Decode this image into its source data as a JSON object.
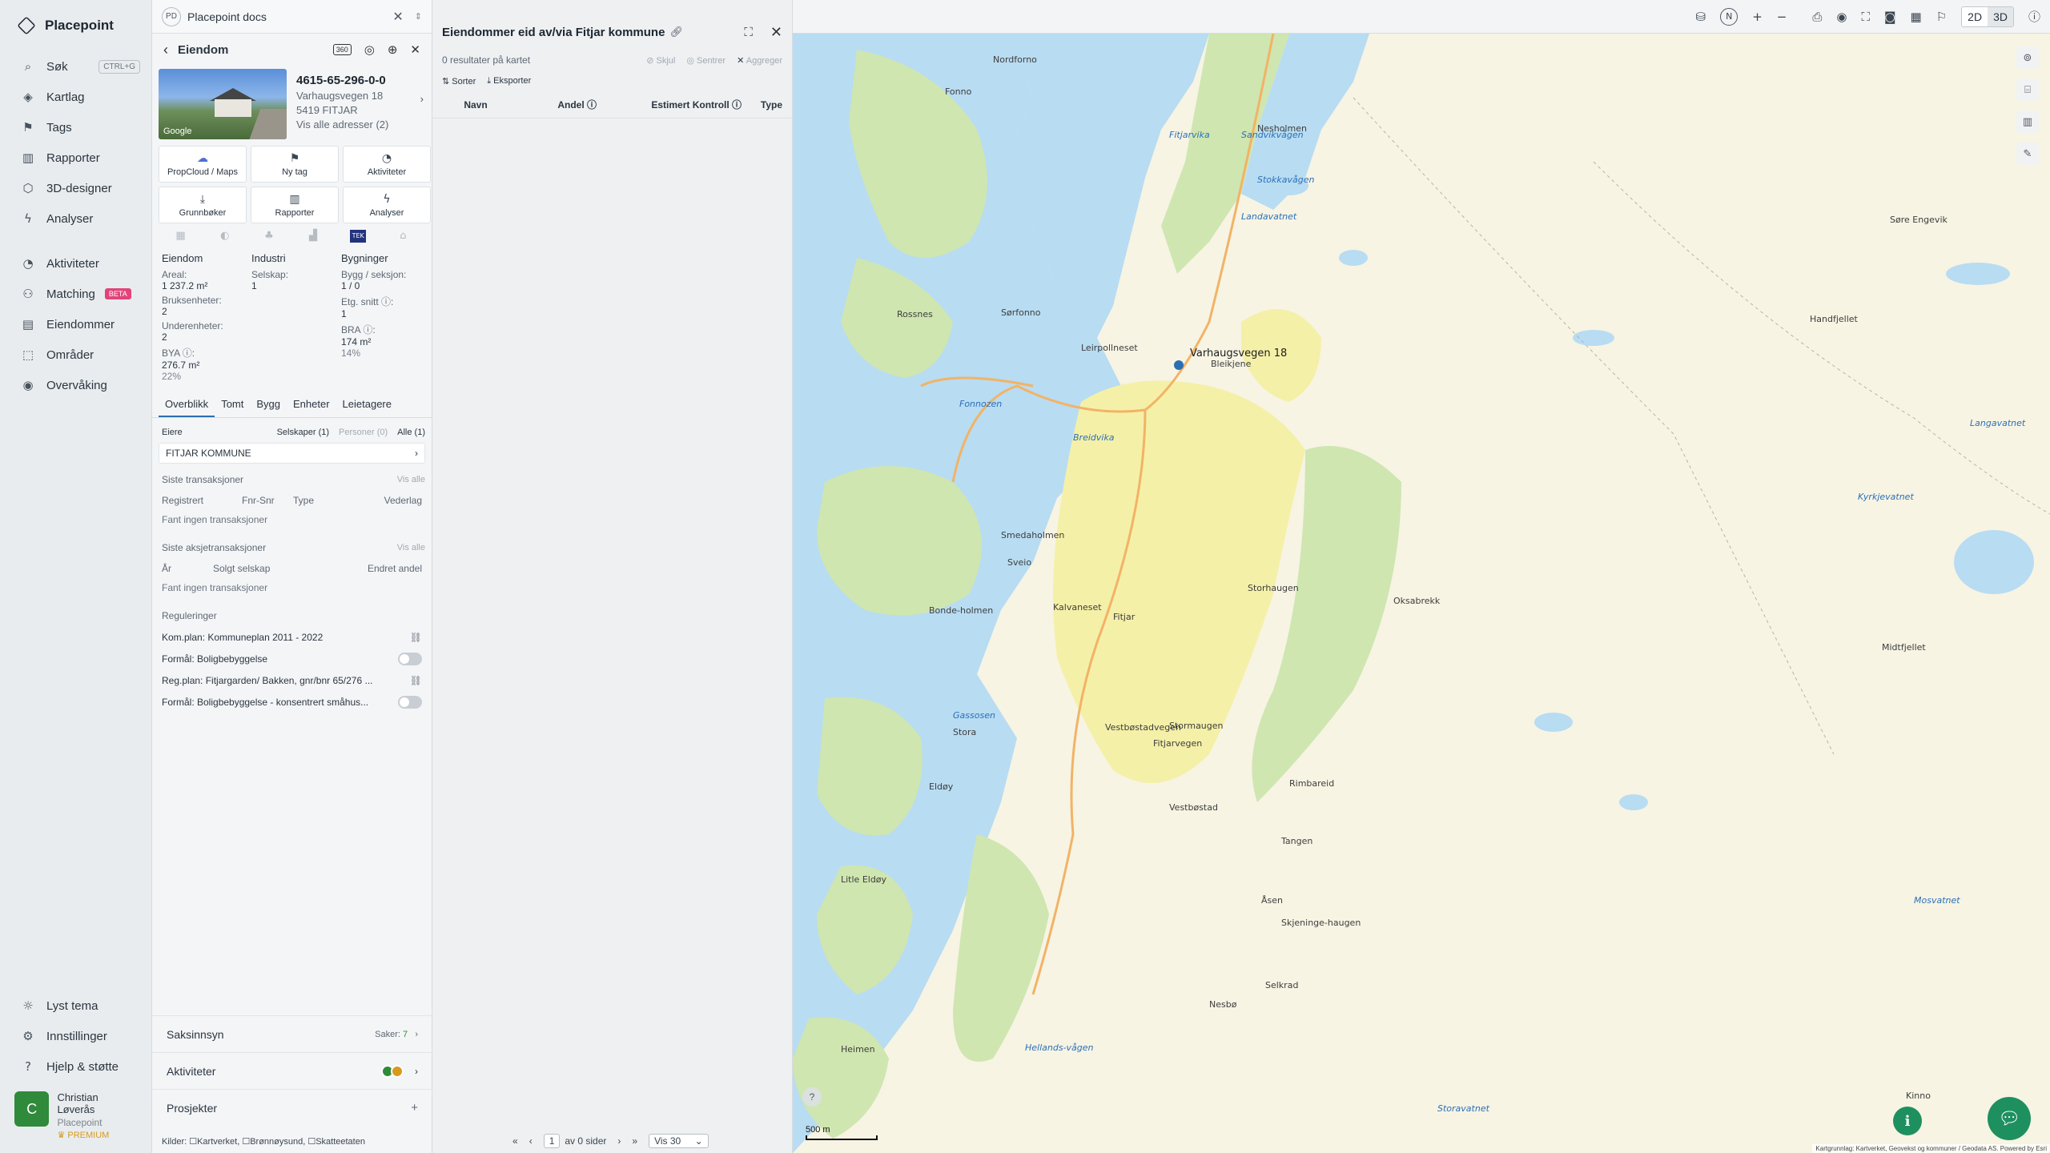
{
  "nav": {
    "brand": "Placepoint",
    "items": [
      {
        "label": "Søk",
        "icon": "search-icon",
        "glyph": "⌕",
        "kbd": "CTRL+G"
      },
      {
        "label": "Kartlag",
        "icon": "layers-icon",
        "glyph": "◈"
      },
      {
        "label": "Tags",
        "icon": "bookmark-icon",
        "glyph": "⚑"
      },
      {
        "label": "Rapporter",
        "icon": "chart-icon",
        "glyph": "▥"
      },
      {
        "label": "3D-designer",
        "icon": "cube-icon",
        "glyph": "⬡"
      },
      {
        "label": "Analyser",
        "icon": "bolt-icon",
        "glyph": "ϟ"
      }
    ],
    "items2": [
      {
        "label": "Aktiviteter",
        "icon": "activity-icon",
        "glyph": "◔"
      },
      {
        "label": "Matching",
        "icon": "matching-icon",
        "glyph": "⚇",
        "badge": "BETA"
      },
      {
        "label": "Eiendommer",
        "icon": "buildings-icon",
        "glyph": "▤"
      },
      {
        "label": "Områder",
        "icon": "area-icon",
        "glyph": "⬚"
      },
      {
        "label": "Overvåking",
        "icon": "monitor-icon",
        "glyph": "◉"
      }
    ],
    "bottom": [
      {
        "label": "Lyst tema",
        "icon": "sun-icon",
        "glyph": "☼"
      },
      {
        "label": "Innstillinger",
        "icon": "gear-icon",
        "glyph": "⚙"
      },
      {
        "label": "Hjelp & støtte",
        "icon": "help-icon",
        "glyph": "?"
      }
    ],
    "user": {
      "initial": "C",
      "name": "Christian Løverås",
      "org": "Placepoint",
      "plan": "PREMIUM"
    }
  },
  "docs": {
    "badge": "PD",
    "title": "Placepoint docs"
  },
  "property": {
    "header": "Eiendom",
    "id": "4615-65-296-0-0",
    "address": "Varhaugsvegen 18",
    "postal": "5419 FITJAR",
    "all_addresses": "Vis alle adresser (2)",
    "thumb_label": "Google",
    "actions": [
      {
        "label": "PropCloud / Maps",
        "icon": "cloud-icon",
        "glyph": "☁"
      },
      {
        "label": "Ny tag",
        "icon": "tag-icon",
        "glyph": "⚑"
      },
      {
        "label": "Aktiviteter",
        "icon": "activity-icon",
        "glyph": "◔"
      },
      {
        "label": "Grunnbøker",
        "icon": "download-icon",
        "glyph": "⤓"
      },
      {
        "label": "Rapporter",
        "icon": "chart-icon",
        "glyph": "▥"
      },
      {
        "label": "Analyser",
        "icon": "bolt-icon",
        "glyph": "ϟ"
      }
    ],
    "tek_label": "TEK",
    "stats": {
      "col1": {
        "head": "Eiendom",
        "areal_label": "Areal:",
        "areal": "1 237.2 m²",
        "bruks_label": "Bruksenheter:",
        "bruks": "2",
        "under_label": "Underenheter:",
        "under": "2",
        "bya_label": "BYA ⓘ:",
        "bya": "276.7 m²",
        "bya_pct": "22%"
      },
      "col2": {
        "head": "Industri",
        "selskap_label": "Selskap:",
        "selskap": "1"
      },
      "col3": {
        "head": "Bygninger",
        "bygg_label": "Bygg / seksjon:",
        "bygg": "1 / 0",
        "etg_label": "Etg. snitt ⓘ:",
        "etg": "1",
        "bra_label": "BRA ⓘ:",
        "bra": "174 m²",
        "bra_pct": "14%"
      }
    },
    "tabs": [
      "Overblikk",
      "Tomt",
      "Bygg",
      "Enheter",
      "Leietagere"
    ],
    "owners": {
      "title": "Eiere",
      "companies": "Selskaper (1)",
      "persons": "Personer (0)",
      "all": "Alle (1)",
      "owner": "FITJAR KOMMUNE"
    },
    "transactions": {
      "title": "Siste transaksjoner",
      "show_all": "Vis alle",
      "cols": [
        "Registrert",
        "Fnr-Snr",
        "Type",
        "Vederlag"
      ],
      "empty": "Fant ingen transaksjoner"
    },
    "share_tx": {
      "title": "Siste aksjetransaksjoner",
      "show_all": "Vis alle",
      "cols": [
        "År",
        "Solgt selskap",
        "Endret andel"
      ],
      "empty": "Fant ingen transaksjoner"
    },
    "regulations": {
      "title": "Reguleringer",
      "rows": [
        {
          "label": "Kom.plan: Kommuneplan 2011 - 2022",
          "kind": "link"
        },
        {
          "label": "Formål: Boligbebyggelse",
          "kind": "toggle"
        },
        {
          "label": "Reg.plan: Fitjargarden/ Bakken, gnr/bnr 65/276 ...",
          "kind": "link"
        },
        {
          "label": "Formål: Boligbebyggelse - konsentrert småhus...",
          "kind": "toggle"
        }
      ]
    },
    "saksinnsyn": {
      "label": "Saksinnsyn",
      "count_label": "Saker:",
      "count": "7"
    },
    "aktiviteter": "Aktiviteter",
    "prosjekter": "Prosjekter",
    "sources": "Kilder: ☐Kartverket, ☐Brønnøysund, ☐Skatteetaten"
  },
  "list": {
    "title": "Eiendommer eid av/via Fitjar kommune",
    "results": "0 resultater på kartet",
    "hide": "Skjul",
    "center": "Sentrer",
    "aggregate": "Aggreger",
    "sort": "Sorter",
    "export": "Eksporter",
    "columns": [
      "Navn",
      "Andel ⓘ",
      "Estimert Kontroll ⓘ",
      "Type"
    ],
    "pager": {
      "page": "1",
      "of": "av 0 sider",
      "per": "Vis 30"
    }
  },
  "toolbar": {
    "mode2d": "2D",
    "mode3d": "3D",
    "north": "N"
  },
  "map": {
    "pin_label": "Varhaugsvegen 18",
    "scale": "500 m",
    "attribution": "Kartgrunnlag: Kartverket, Geovekst og kommuner / Geodata AS. Powered by Esri",
    "colors": {
      "water": "#b8dcf2",
      "forest": "#cfe6b0",
      "urban": "#f5f0a8",
      "road": "#f2b366"
    },
    "labels": [
      {
        "t": "Nordforno"
      },
      {
        "t": "Fonno"
      },
      {
        "t": "Nesholmen"
      },
      {
        "t": "Fitjarvika"
      },
      {
        "t": "Sandvikvågen"
      },
      {
        "t": "Stokkavågen"
      },
      {
        "t": "Landavatnet"
      },
      {
        "t": "Fonnozen"
      },
      {
        "t": "Rossnes"
      },
      {
        "t": "Sørfonno"
      },
      {
        "t": "Leirpollneset"
      },
      {
        "t": "Bleikjene"
      },
      {
        "t": "Breidvika"
      },
      {
        "t": "Storhaugen"
      },
      {
        "t": "Oksabrekk"
      },
      {
        "t": "Fitjar"
      },
      {
        "t": "Smedaholmen"
      },
      {
        "t": "Sveio"
      },
      {
        "t": "Kalvaneset"
      },
      {
        "t": "Bonde-holmen"
      },
      {
        "t": "Vestbøstadvegen"
      },
      {
        "t": "Fitjarvegen"
      },
      {
        "t": "Stormaugen"
      },
      {
        "t": "Vestbøstad"
      },
      {
        "t": "Rimbareid"
      },
      {
        "t": "Tangen"
      },
      {
        "t": "Åsen"
      },
      {
        "t": "Skjeninge-haugen"
      },
      {
        "t": "Selkrad"
      },
      {
        "t": "Nesbø"
      },
      {
        "t": "Midtfjellet"
      },
      {
        "t": "Handfjellet"
      },
      {
        "t": "Storavatnet"
      },
      {
        "t": "Gassosen"
      },
      {
        "t": "Stora"
      },
      {
        "t": "Eldøy"
      },
      {
        "t": "Litle Eldøy"
      },
      {
        "t": "Heimen"
      },
      {
        "t": "Hellands-vågen"
      },
      {
        "t": "Søre Engevik"
      },
      {
        "t": "Kinno"
      },
      {
        "t": "Mosvatnet"
      },
      {
        "t": "Kyrkjevatnet"
      },
      {
        "t": "Langavatnet"
      }
    ]
  }
}
